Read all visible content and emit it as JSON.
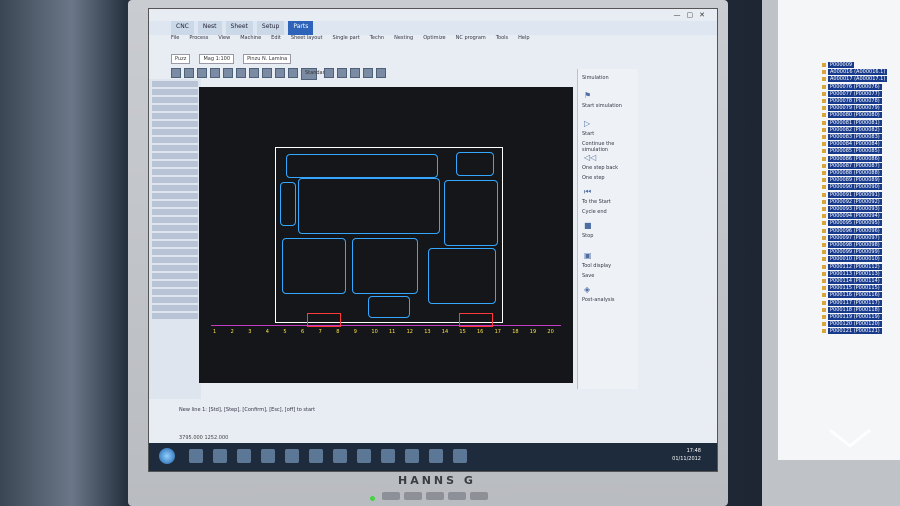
{
  "monitor": {
    "brand": "HANNS G"
  },
  "app": {
    "tabs": [
      "CNC",
      "Nest",
      "Sheet",
      "Setup",
      "Parts"
    ],
    "active_tab": 4,
    "menu": [
      "File",
      "Process",
      "View",
      "Machine",
      "Edit",
      "Sheet layout",
      "Single part",
      "Techn",
      "Nesting",
      "Optimize",
      "NC program",
      "Tools",
      "Help"
    ],
    "toolbar": {
      "part_combo": "Puzz",
      "scale_combo": "Mag 1:100",
      "mode_combo": "Standard",
      "layer_combo": "Pinzu N. Lamina"
    },
    "dialog": {
      "title": "Simulation",
      "items": [
        "Start simulation",
        "Start",
        "Continue the simulation",
        "One step back",
        "One step",
        "To the Start",
        "Cycle end",
        "Stop",
        "Tool display",
        "Save",
        "Post-analysis"
      ]
    },
    "cmdline": "New line 1: [Std], [Step], [Confirm], [Esc], [off] to start",
    "status": "3795.000   1252.000",
    "taskbar": {
      "time": "17:48",
      "date": "01/11/2012"
    }
  },
  "ruler_ticks": [
    "1",
    "2",
    "3",
    "4",
    "5",
    "6",
    "7",
    "8",
    "9",
    "10",
    "11",
    "12",
    "13",
    "14",
    "15",
    "16",
    "17",
    "18",
    "19",
    "20"
  ],
  "tree": {
    "items": [
      "P000009",
      "A000016 (A000016.1)",
      "A000017 (A000017.1)",
      "P000076 (P000076)",
      "P000077 (P000077)",
      "P000078 (P000078)",
      "P000079 (P000079)",
      "P000080 (P000080)",
      "P000081 (P000081)",
      "P000082 (P000082)",
      "P000083 (P000083)",
      "P000084 (P000084)",
      "P000085 (P000085)",
      "P000086 (P000086)",
      "P000087 (P000087)",
      "P000088 (P000088)",
      "P000089 (P000089)",
      "P000090 (P000090)",
      "P000091 (P000091)",
      "P000092 (P000092)",
      "P000093 (P000093)",
      "P000094 (P000094)",
      "P000095 (P000095)",
      "P000096 (P000096)",
      "P000097 (P000097)",
      "P000098 (P000098)",
      "P000099 (P000099)",
      "P000010 (P000010)",
      "P000112 (P000112)",
      "P000113 (P000113)",
      "P000114 (P000114)",
      "P000115 (P000115)",
      "P000116 (P000116)",
      "P000117 (P000117)",
      "P000118 (P000118)",
      "P000119 (P000119)",
      "P000120 (P000120)",
      "P000121 (P000121)"
    ]
  }
}
